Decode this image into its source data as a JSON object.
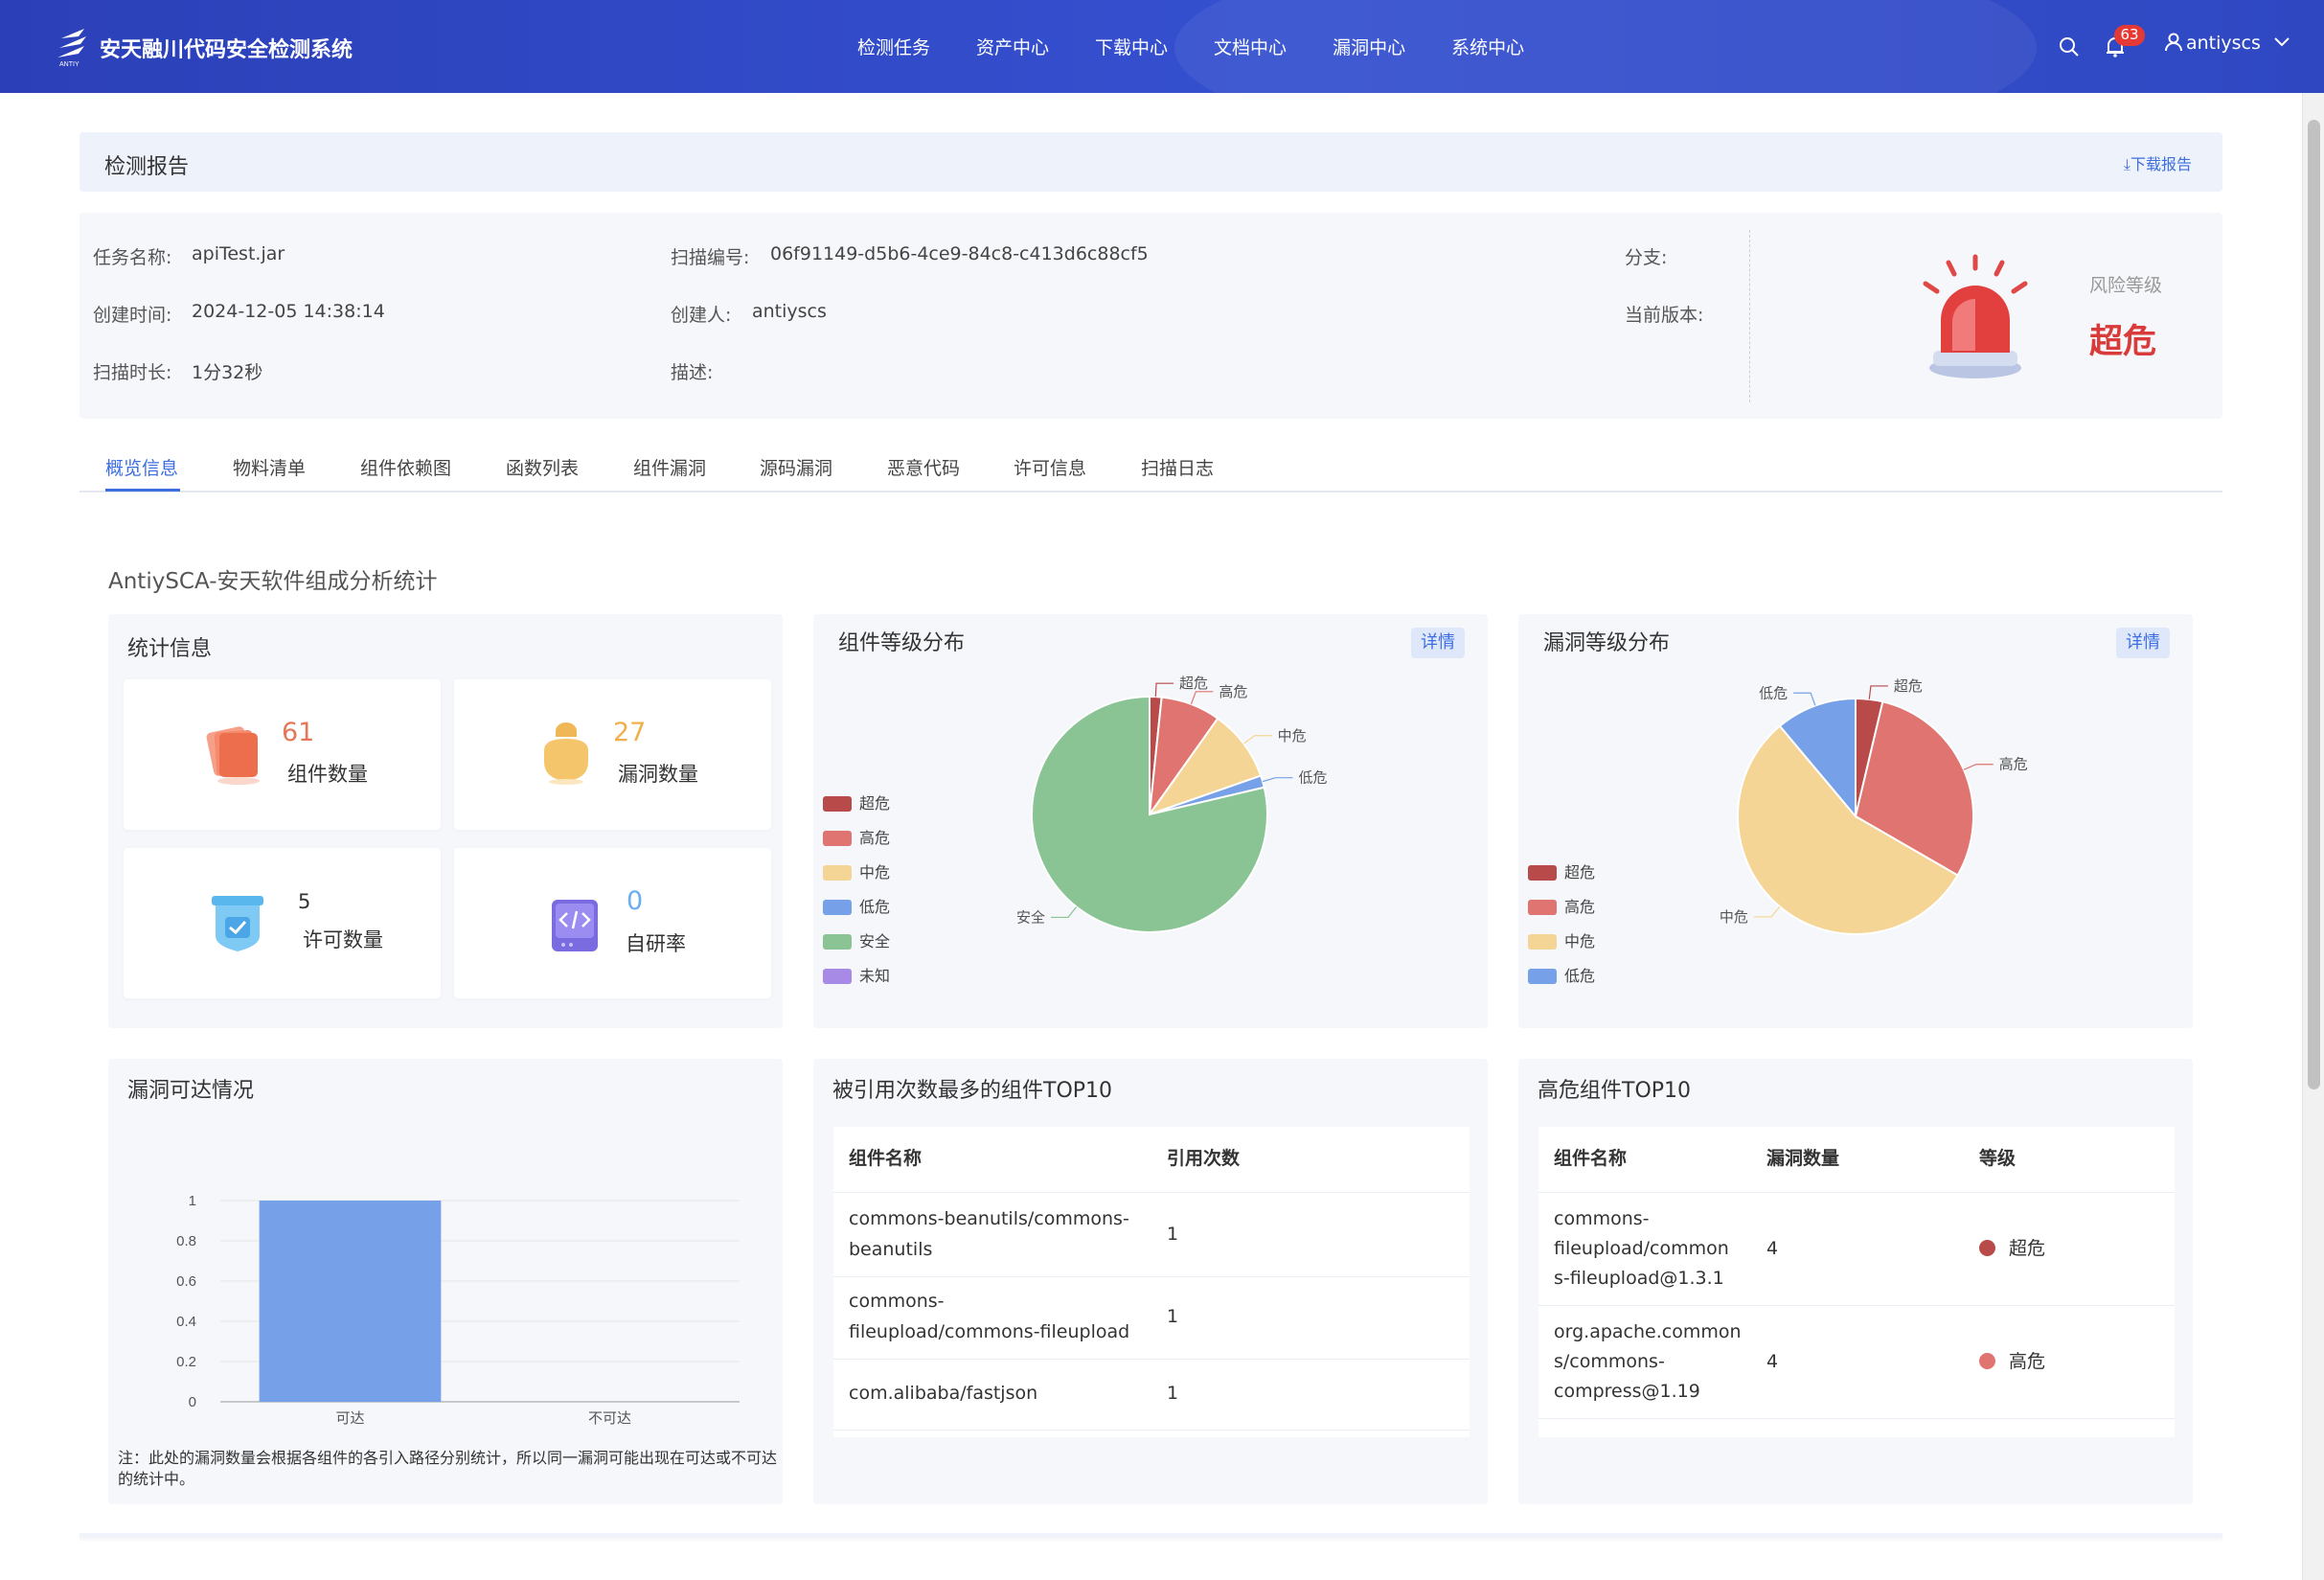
{
  "header": {
    "app_title": "安天融川代码安全检测系统",
    "nav": [
      "检测任务",
      "资产中心",
      "下载中心",
      "文档中心",
      "漏洞中心",
      "系统中心"
    ],
    "notification_count": "63",
    "username": "antiyscs"
  },
  "report": {
    "title": "检测报告",
    "download_label": "下载报告",
    "fields": {
      "task_name_label": "任务名称:",
      "task_name": "apiTest.jar",
      "scan_id_label": "扫描编号:",
      "scan_id": "06f91149-d5b6-4ce9-84c8-c413d6c88cf5",
      "branch_label": "分支:",
      "created_label": "创建时间:",
      "created": "2024-12-05 14:38:14",
      "creator_label": "创建人:",
      "creator": "antiyscs",
      "version_label": "当前版本:",
      "duration_label": "扫描时长:",
      "duration": "1分32秒",
      "desc_label": "描述:"
    },
    "risk_label": "风险等级",
    "risk_value": "超危"
  },
  "tabs": [
    "概览信息",
    "物料清单",
    "组件依赖图",
    "函数列表",
    "组件漏洞",
    "源码漏洞",
    "恶意代码",
    "许可信息",
    "扫描日志"
  ],
  "section_title": "AntiySCA-安天软件组成分析统计",
  "stats": {
    "title": "统计信息",
    "components": {
      "value": "61",
      "label": "组件数量"
    },
    "vulns": {
      "value": "27",
      "label": "漏洞数量"
    },
    "licenses": {
      "value": "5",
      "label": "许可数量"
    },
    "selfdev": {
      "value": "0",
      "label": "自研率"
    }
  },
  "detail_label": "详情",
  "colors": {
    "critical": "#b84a4a",
    "high": "#e07470",
    "medium": "#f5d595",
    "low": "#76a0e8",
    "safe": "#8ac495",
    "unknown": "#a68ae6",
    "accent": "#3c6ee0"
  },
  "component_pie_title": "组件等级分布",
  "vuln_pie_title": "漏洞等级分布",
  "reach_title": "漏洞可达情况",
  "reach_note": "注：此处的漏洞数量会根据各组件的各引入路径分别统计，所以同一漏洞可能出现在可达或不可达的统计中。",
  "chart_data": [
    {
      "type": "pie",
      "title": "组件等级分布",
      "labels": [
        "超危",
        "高危",
        "中危",
        "低危",
        "安全",
        "未知"
      ],
      "legend": [
        "超危",
        "高危",
        "中危",
        "低危",
        "安全",
        "未知"
      ],
      "values": [
        1,
        5,
        6,
        1,
        48,
        0
      ]
    },
    {
      "type": "pie",
      "title": "漏洞等级分布",
      "labels": [
        "超危",
        "高危",
        "中危",
        "低危"
      ],
      "legend": [
        "超危",
        "高危",
        "中危",
        "低危"
      ],
      "values": [
        1,
        8,
        15,
        3
      ]
    },
    {
      "type": "bar",
      "title": "漏洞可达情况",
      "categories": [
        "可达",
        "不可达"
      ],
      "values": [
        1,
        0
      ],
      "ylim": [
        0,
        1
      ],
      "yticks": [
        "0",
        "0.2",
        "0.4",
        "0.6",
        "0.8",
        "1"
      ]
    }
  ],
  "top_ref": {
    "title": "被引用次数最多的组件TOP10",
    "headers": [
      "组件名称",
      "引用次数"
    ],
    "rows": [
      {
        "name1": "commons-beanutils/commons-",
        "name2": "beanutils",
        "count": "1"
      },
      {
        "name1": "commons-",
        "name2": "fileupload/commons-fileupload",
        "count": "1"
      },
      {
        "name1": "com.alibaba/fastjson",
        "name2": "",
        "count": "1"
      }
    ]
  },
  "top_risk": {
    "title": "高危组件TOP10",
    "headers": [
      "组件名称",
      "漏洞数量",
      "等级"
    ],
    "rows": [
      {
        "l1": "commons-",
        "l2": "fileupload/common",
        "l3": "s-fileupload@1.3.1",
        "count": "4",
        "level": "超危"
      },
      {
        "l1": "org.apache.common",
        "l2": "s/commons-",
        "l3": "compress@1.19",
        "count": "4",
        "level": "高危"
      }
    ]
  }
}
